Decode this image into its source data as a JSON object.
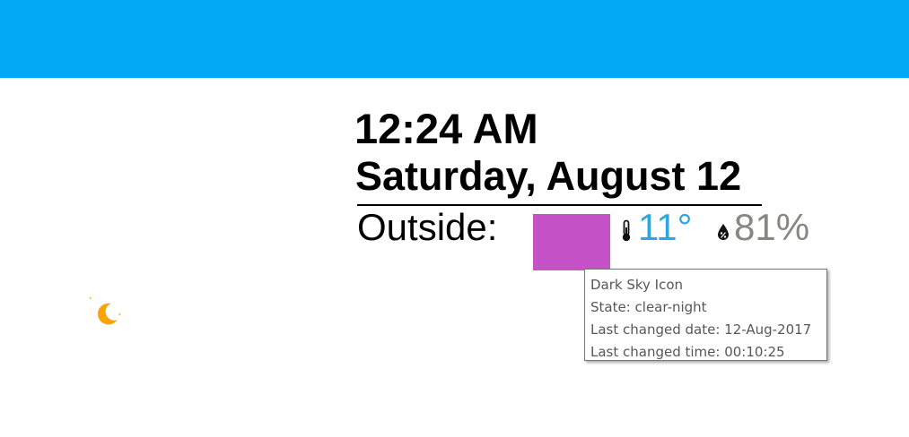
{
  "header": {
    "color": "#03a9f4"
  },
  "clock": {
    "time": "12:24 AM",
    "date": "Saturday, August 12"
  },
  "weather": {
    "outside_label": "Outside:",
    "icon_box_color": "#c652c8",
    "temperature_icon": "thermometer-icon",
    "temperature": "11°",
    "temperature_color": "#2fa6dd",
    "humidity_icon": "water-drop-percent-icon",
    "humidity": "81%",
    "humidity_color": "#8a8682"
  },
  "tooltip": {
    "title": "Dark Sky Icon",
    "state": "State: clear-night",
    "last_changed_date": "Last changed date: 12-Aug-2017",
    "last_changed_time": "Last changed time: 00:10:25"
  },
  "side_icon": {
    "name": "clear-night-moon-icon",
    "color": "#f9a400"
  }
}
